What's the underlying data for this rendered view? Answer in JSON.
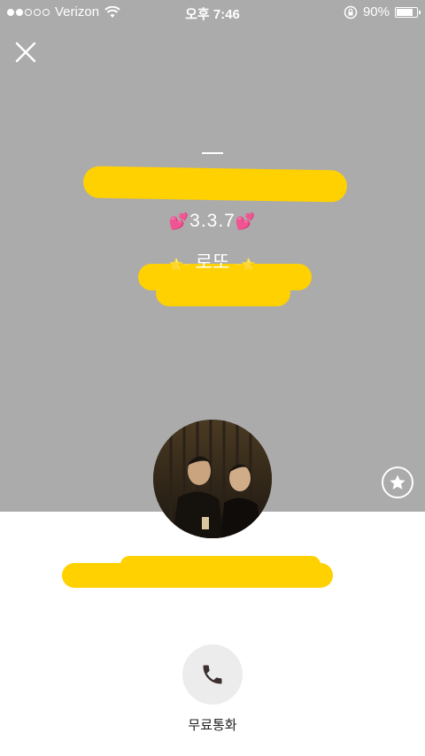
{
  "status_bar": {
    "carrier": "Verizon",
    "time": "오후 7:46",
    "battery": "90%",
    "battery_level": 0.9,
    "signal_bars_filled": 2,
    "signal_bars_total": 5
  },
  "profile": {
    "status_message": "3.3.7",
    "name_tag": "로또"
  },
  "actions": {
    "call_label": "무료통화"
  },
  "colors": {
    "cover_background": "#ababab",
    "redaction": "#ffd100",
    "call_button_bg": "#ececec"
  }
}
